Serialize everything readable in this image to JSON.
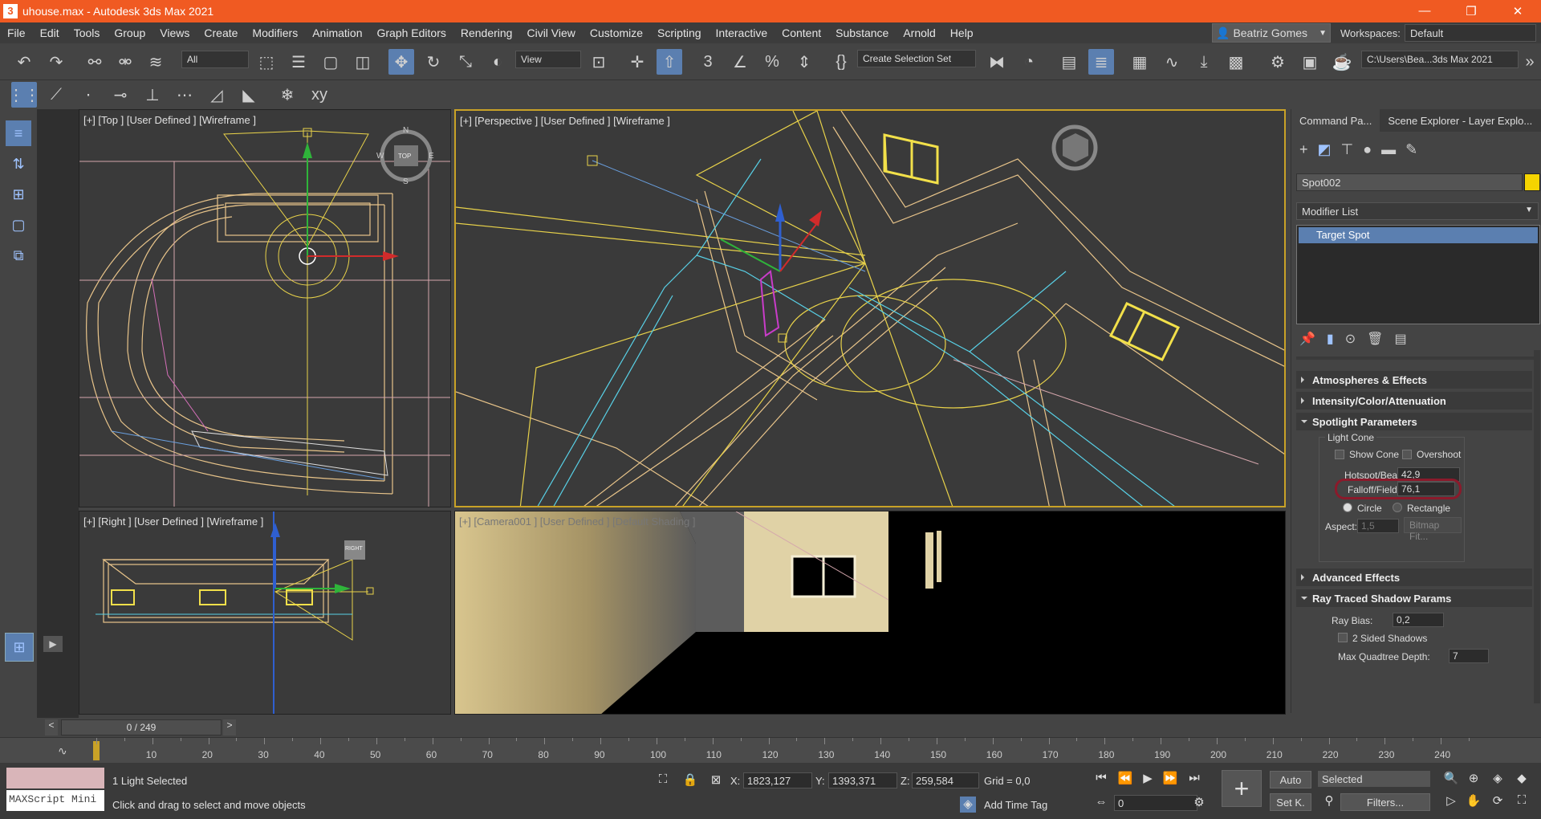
{
  "window": {
    "icon": "3",
    "title": "uhouse.max - Autodesk 3ds Max 2021",
    "minimize": "—",
    "maximize": "❐",
    "close": "✕"
  },
  "menu": [
    "File",
    "Edit",
    "Tools",
    "Group",
    "Views",
    "Create",
    "Modifiers",
    "Animation",
    "Graph Editors",
    "Rendering",
    "Civil View",
    "Customize",
    "Scripting",
    "Interactive",
    "Content",
    "Substance",
    "Arnold",
    "Help"
  ],
  "user": {
    "name": "Beatriz Gomes",
    "workspaces_label": "Workspaces:",
    "workspace": "Default"
  },
  "toolbar": {
    "filter": "All",
    "ref_coord": "View",
    "selection_set": "Create Selection Set",
    "project_path": "C:\\Users\\Bea...3ds Max 2021"
  },
  "viewports": {
    "top": {
      "label": "[+] [Top ] [User Defined ] [Wireframe ]",
      "cube": "TOP",
      "compass": [
        "N",
        "W",
        "E",
        "S"
      ]
    },
    "perspective": {
      "label": "[+] [Perspective ] [User Defined ] [Wireframe ]"
    },
    "right": {
      "label": "[+] [Right ] [User Defined ] [Wireframe ]",
      "cube": "RIGHT"
    },
    "camera": {
      "label": "[+] [Camera001 ] [User Defined ] [Default Shading ]"
    }
  },
  "command_panel": {
    "tabs": [
      "Command Pa...",
      "Scene Explorer - Layer Explo..."
    ],
    "object_name": "Spot002",
    "object_color": "#f5d400",
    "modifier_list": "Modifier List",
    "stack_item": "Target Spot",
    "rollouts": {
      "atmos": "Atmospheres & Effects",
      "intensity": "Intensity/Color/Attenuation",
      "spot": "Spotlight Parameters",
      "advanced": "Advanced Effects",
      "raytrace": "Ray Traced Shadow Params"
    },
    "spot": {
      "group": "Light Cone",
      "show_cone": "Show Cone",
      "overshoot": "Overshoot",
      "hotspot_label": "Hotspot/Beam:",
      "hotspot": "42,9",
      "falloff_label": "Falloff/Field:",
      "falloff": "76,1",
      "circle": "Circle",
      "rectangle": "Rectangle",
      "aspect_label": "Aspect:",
      "aspect": "1,5",
      "bitmap_fit": "Bitmap Fit..."
    },
    "raytrace": {
      "bias_label": "Ray Bias:",
      "bias": "0,2",
      "two_sided": "2 Sided Shadows",
      "depth_label": "Max Quadtree Depth:",
      "depth": "7"
    }
  },
  "timeline": {
    "frame": "0 / 249",
    "prev": "<",
    "next": ">",
    "ticks": [
      "10",
      "20",
      "30",
      "40",
      "50",
      "60",
      "70",
      "80",
      "90",
      "100",
      "110",
      "120",
      "130",
      "140",
      "150",
      "160",
      "170",
      "180",
      "190",
      "200",
      "210",
      "220",
      "230",
      "240"
    ]
  },
  "status": {
    "maxscript": "MAXScript Mini",
    "selected": "1 Light Selected",
    "prompt": "Click and drag to select and move objects",
    "x_label": "X:",
    "x": "1823,127",
    "y_label": "Y:",
    "y": "1393,371",
    "z_label": "Z:",
    "z": "259,584",
    "grid": "Grid = 0,0",
    "add_time_tag": "Add Time Tag",
    "auto": "Auto",
    "setk": "Set K.",
    "selected_set": "Selected",
    "filters": "Filters...",
    "frame_field": "0"
  }
}
